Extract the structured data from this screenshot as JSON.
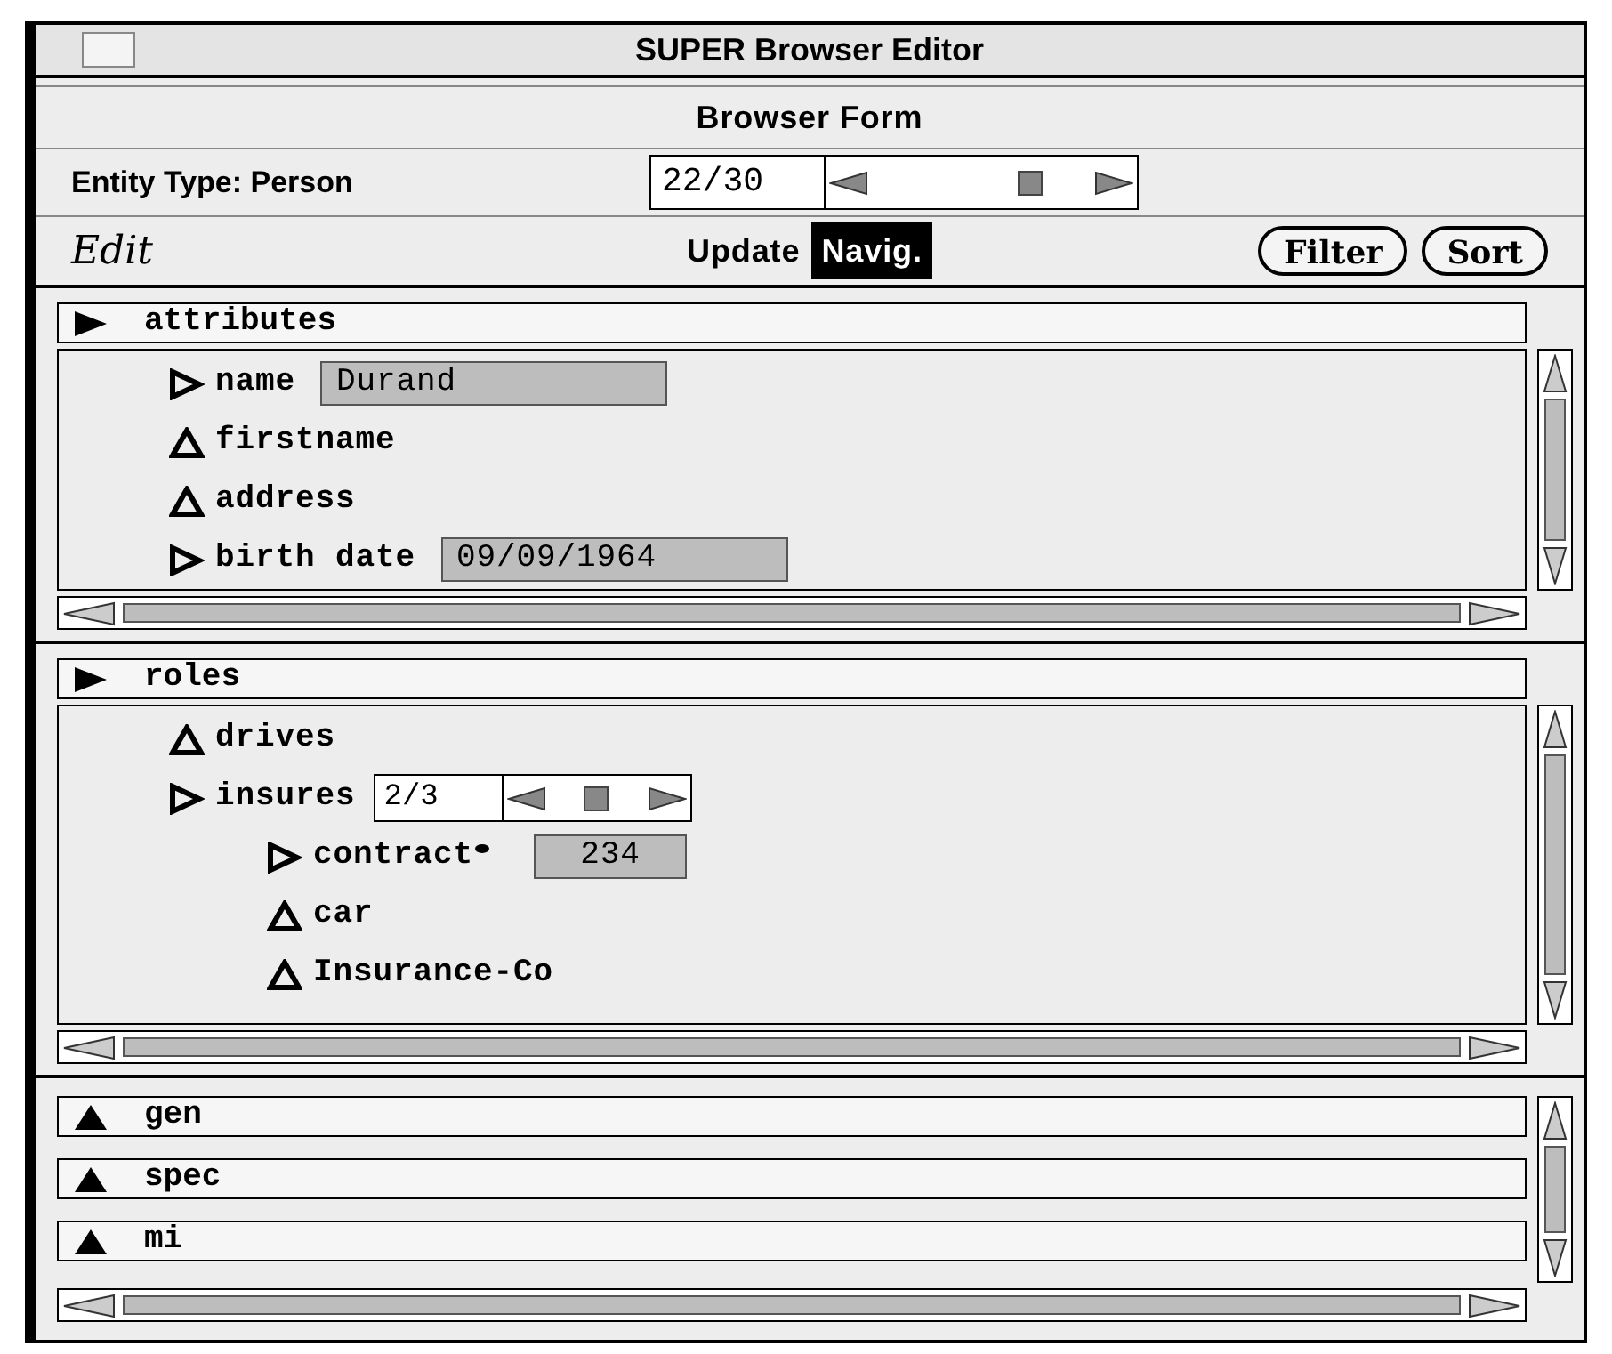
{
  "window": {
    "title": "SUPER Browser Editor"
  },
  "form_title": "Browser Form",
  "entity": {
    "label": "Entity Type: Person",
    "counter": "22/30",
    "level": 0.72
  },
  "toolbar": {
    "menu": "Edit",
    "modes": [
      {
        "label": "Update",
        "selected": false
      },
      {
        "label": "Navig.",
        "selected": true
      }
    ],
    "buttons": [
      "Filter",
      "Sort"
    ]
  },
  "panes": [
    {
      "sections": [
        {
          "header": "attributes",
          "expanded": true,
          "items": [
            {
              "kind": "value",
              "label": "name",
              "value": "Durand"
            },
            {
              "kind": "empty",
              "label": "firstname"
            },
            {
              "kind": "empty",
              "label": "address"
            },
            {
              "kind": "value",
              "label": "birth date",
              "value": "09/09/1964"
            }
          ]
        }
      ]
    },
    {
      "sections": [
        {
          "header": "roles",
          "expanded": true,
          "items": [
            {
              "kind": "empty",
              "label": "drives"
            },
            {
              "kind": "counter",
              "label": "insures",
              "counter": "2/3",
              "level": 0.5,
              "children": [
                {
                  "kind": "value",
                  "label": "contract",
                  "marked": true,
                  "value": "234"
                },
                {
                  "kind": "empty",
                  "label": "car"
                },
                {
                  "kind": "empty",
                  "label": "Insurance-Co"
                }
              ]
            }
          ]
        }
      ]
    },
    {
      "sections": [
        {
          "header": "gen",
          "expanded": false
        },
        {
          "header": "spec",
          "expanded": false
        },
        {
          "header": "mi",
          "expanded": false
        }
      ]
    }
  ]
}
